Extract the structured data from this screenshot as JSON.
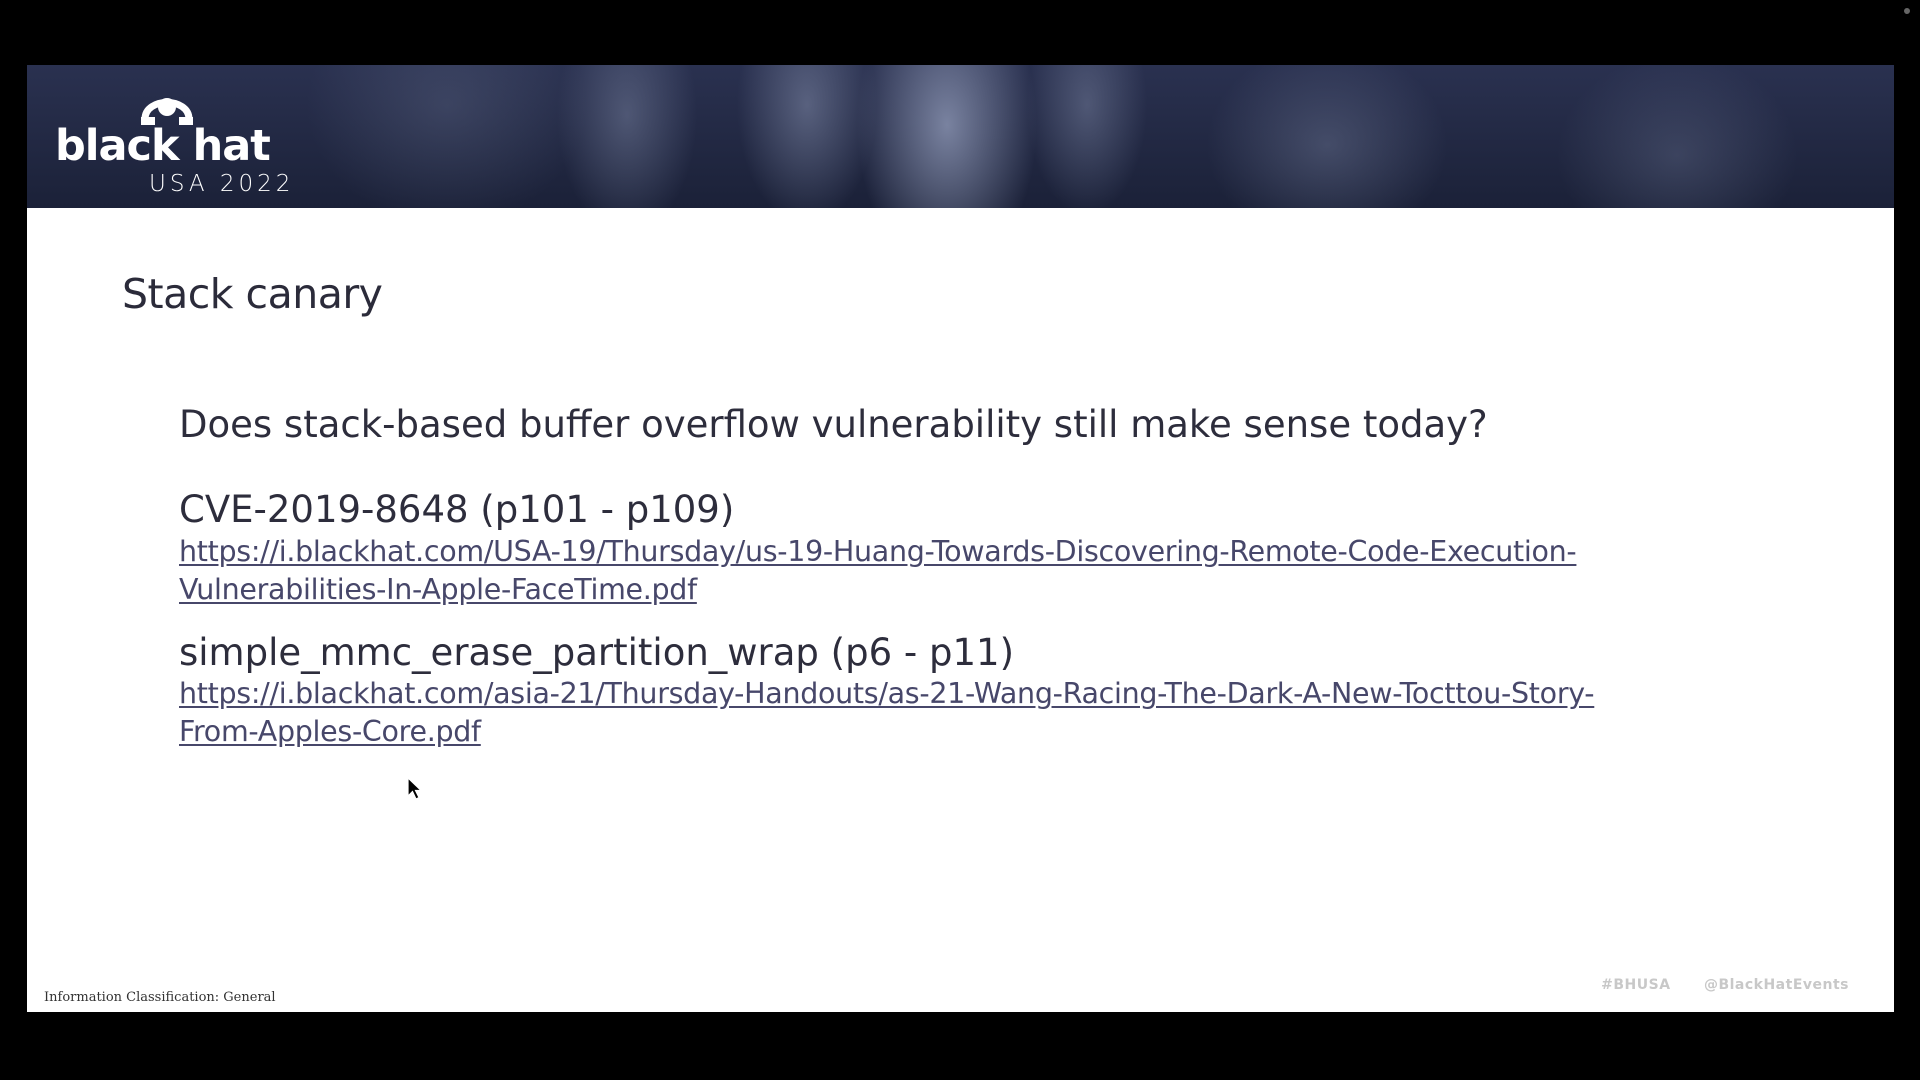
{
  "window": {
    "title": ""
  },
  "slide": {
    "logo": {
      "wordmark": "black hat",
      "subtitle": "USA 2022"
    },
    "title": "Stack canary",
    "question": "Does stack-based buffer overflow vulnerability still make sense today?",
    "references": [
      {
        "title": "CVE-2019-8648 (p101 - p109)",
        "link_line1": "https://i.blackhat.com/USA-19/Thursday/us-19-Huang-Towards-Discovering-Remote-Code-Execution-",
        "link_line2": "Vulnerabilities-In-Apple-FaceTime.pdf"
      },
      {
        "title": "simple_mmc_erase_partition_wrap (p6 - p11)",
        "link_line1": "https://i.blackhat.com/asia-21/Thursday-Handouts/as-21-Wang-Racing-The-Dark-A-New-Tocttou-Story-",
        "link_line2": "From-Apples-Core.pdf"
      }
    ],
    "footer": {
      "classification": "Information Classification: General",
      "hashtag": "#BHUSA",
      "handle": "@BlackHatEvents"
    }
  },
  "colors": {
    "banner": "#1b2138",
    "text": "#2d2d3c",
    "link": "#47476a",
    "background": "#000000"
  },
  "icons": {
    "logo": "black-hat-logo-icon",
    "pointer": "mouse-cursor-icon"
  }
}
